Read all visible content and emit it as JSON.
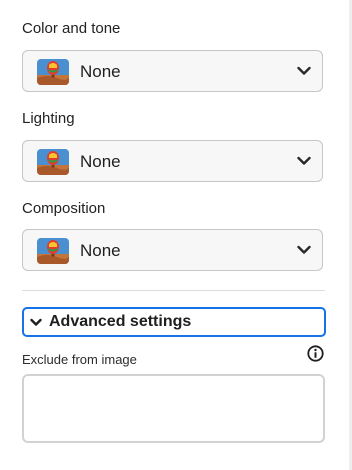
{
  "sections": [
    {
      "label": "Color and tone",
      "value": "None",
      "icon": "hot-air-balloon-thumbnail"
    },
    {
      "label": "Lighting",
      "value": "None",
      "icon": "hot-air-balloon-thumbnail"
    },
    {
      "label": "Composition",
      "value": "None",
      "icon": "hot-air-balloon-thumbnail"
    }
  ],
  "advanced": {
    "label": "Advanced settings",
    "expanded": true
  },
  "exclude": {
    "label": "Exclude from image",
    "value": "",
    "placeholder": ""
  },
  "colors": {
    "accent_focus": "#1473e6",
    "field_bg": "#f7f7f7",
    "border": "#c6c6c6"
  }
}
